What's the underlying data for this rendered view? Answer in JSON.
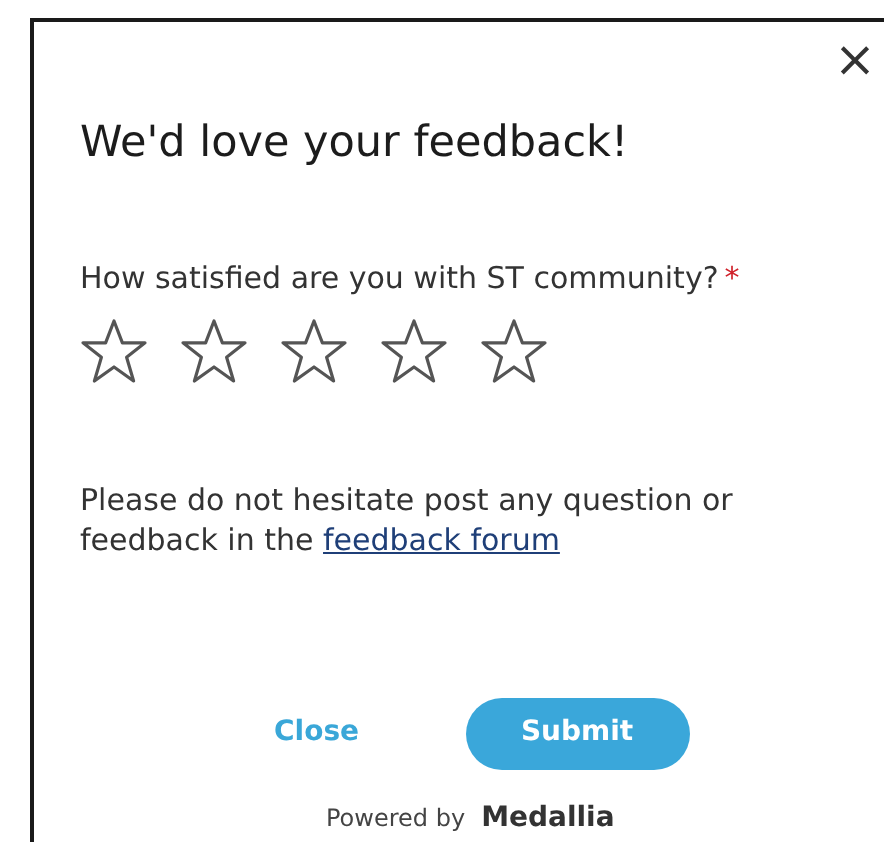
{
  "dialog": {
    "close_icon": "×",
    "title": "We'd love your feedback!",
    "question": {
      "label": "How satisfied are you with ST community?",
      "required_mark": "*",
      "stars": 0
    },
    "message": {
      "text": "Please do not hesitate post any question or feedback in the ",
      "link": "feedback forum"
    },
    "buttons": [
      {
        "kind": "link",
        "label": "Close"
      },
      {
        "kind": "primary",
        "label": "Submit"
      }
    ],
    "footer": {
      "prefix": "Powered by",
      "brand": "Medallia"
    }
  }
}
